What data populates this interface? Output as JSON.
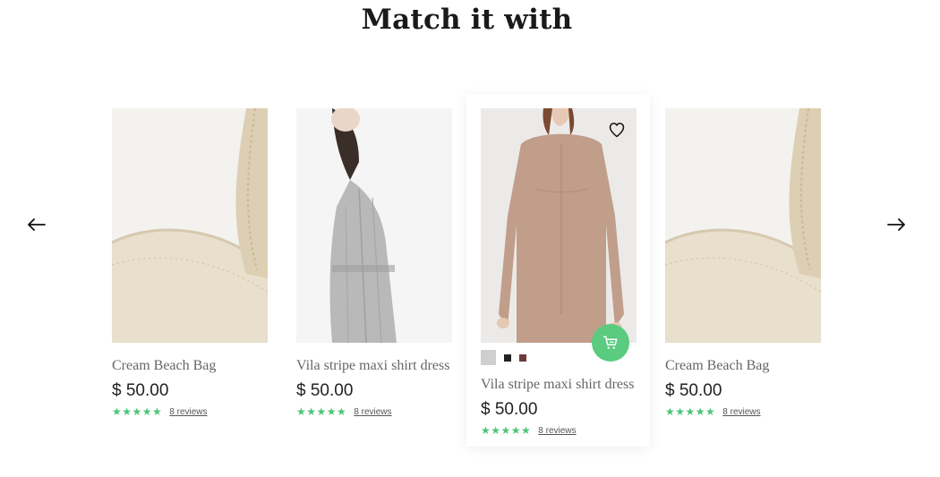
{
  "section": {
    "heading": "Match it with"
  },
  "carousel": {
    "prev_icon": "arrow-left-icon",
    "next_icon": "arrow-right-icon"
  },
  "products": [
    {
      "title": "Cream Beach Bag",
      "price": "$ 50.00",
      "stars": "★★★★★",
      "reviews": "8 reviews"
    },
    {
      "title": "Vila stripe maxi shirt dress",
      "price": "$ 50.00",
      "stars": "★★★★★",
      "reviews": "8 reviews"
    },
    {
      "title": "Vila stripe maxi shirt dress",
      "price": "$ 50.00",
      "stars": "★★★★★",
      "reviews": "8 reviews"
    },
    {
      "title": "Cream Beach Bag",
      "price": "$ 50.00",
      "stars": "★★★★★",
      "reviews": "8 reviews"
    }
  ],
  "active_card": {
    "swatches": [
      "#cfcfcf",
      "#222222",
      "#6e3a3a"
    ],
    "wishlist_icon": "heart-icon",
    "cart_icon": "cart-icon"
  },
  "colors": {
    "accent": "#5acb7f",
    "stars": "#4cc477"
  }
}
